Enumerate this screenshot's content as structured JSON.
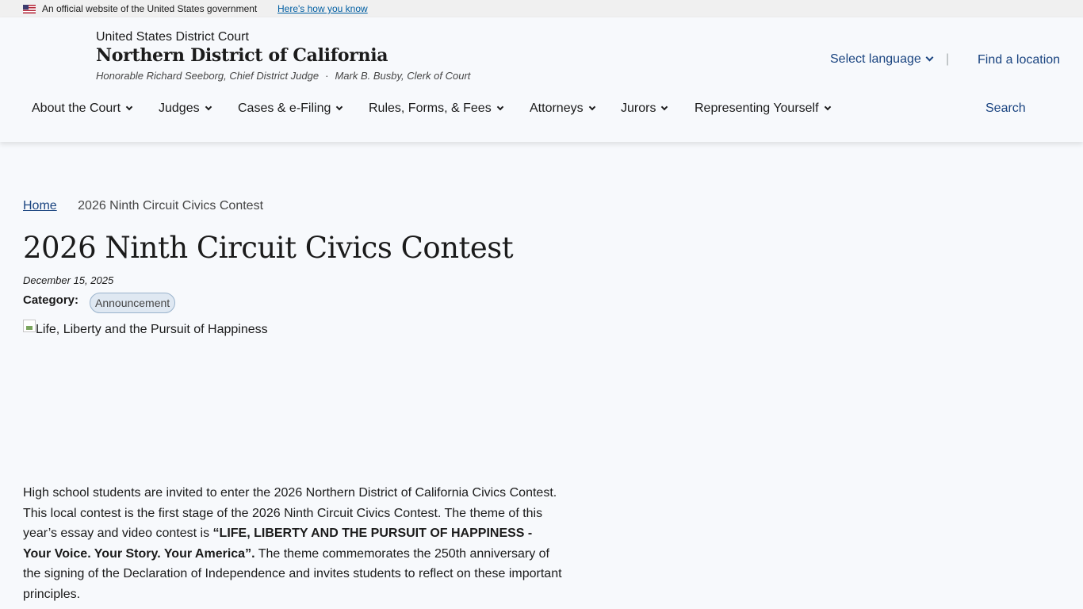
{
  "gov_banner": {
    "official_text": "An official website of the United States government",
    "how_link": "Here's how you know"
  },
  "header": {
    "court": "United States District Court",
    "district": "Northern District of California",
    "judge": "Honorable Richard Seeborg, Chief District Judge",
    "separator": "·",
    "clerk": "Mark B. Busby, Clerk of Court",
    "language": "Select language",
    "divider": "|",
    "find_location": "Find a location",
    "search": "Search"
  },
  "nav": {
    "items": [
      {
        "label": "About the Court"
      },
      {
        "label": "Judges"
      },
      {
        "label": "Cases & e-Filing"
      },
      {
        "label": "Rules, Forms, & Fees"
      },
      {
        "label": "Attorneys"
      },
      {
        "label": "Jurors"
      },
      {
        "label": "Representing Yourself"
      }
    ]
  },
  "breadcrumb": {
    "home": "Home",
    "current": "2026 Ninth Circuit Civics Contest"
  },
  "article": {
    "title": "2026 Ninth Circuit Civics Contest",
    "date": "December 15, 2025",
    "category_label": "Category:",
    "category": "Announcement",
    "image_alt": "Life, Liberty and the Pursuit of Happiness",
    "body_part1": "High school students are invited to enter the 2026 Northern District of California Civics Contest. This local contest is the first stage of the 2026 Ninth Circuit Civics Contest. The theme of this year’s essay and video contest is ",
    "body_bold": "“LIFE, LIBERTY AND THE PURSUIT OF HAPPINESS - Your Voice. Your Story. Your America”.",
    "body_part2": " The theme commemorates the 250th anniversary of the signing of the Declaration of Independence and invites students to reflect on these important principles."
  }
}
